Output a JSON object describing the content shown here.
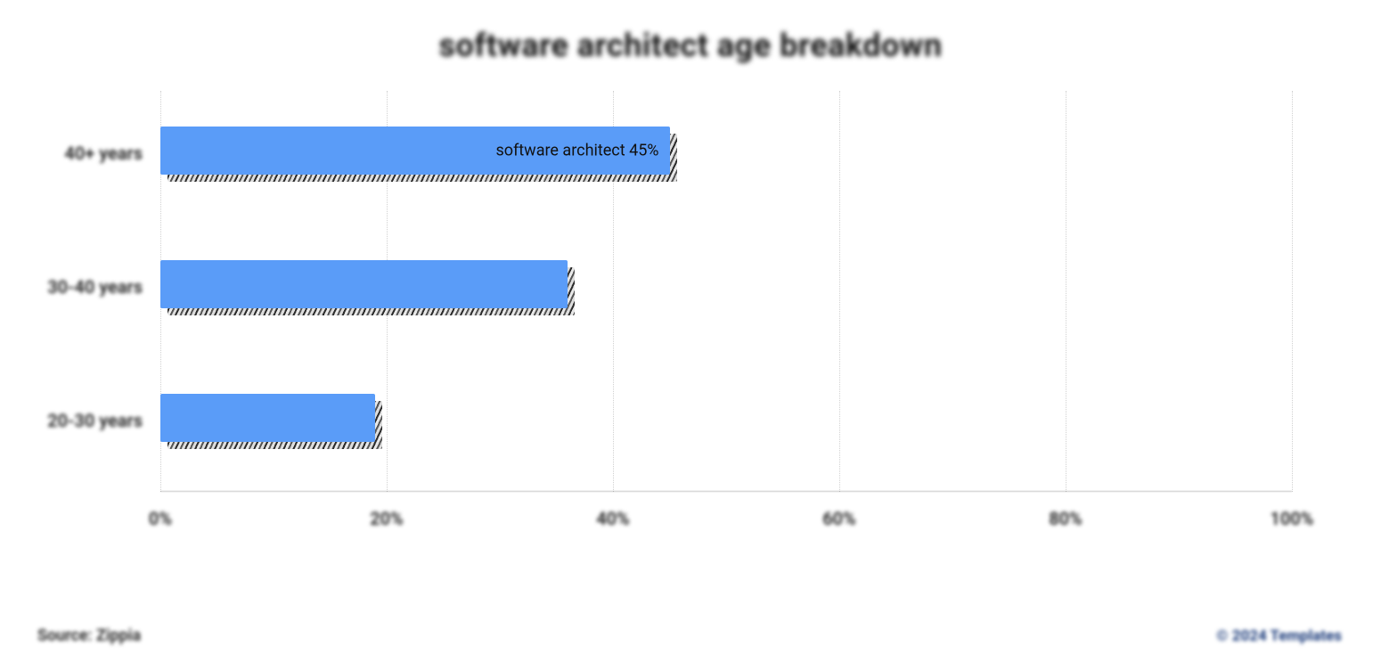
{
  "chart_data": {
    "type": "bar",
    "orientation": "horizontal",
    "title": "software architect age breakdown",
    "categories": [
      "40+ years",
      "30-40 years",
      "20-30 years"
    ],
    "values": [
      45,
      36,
      19
    ],
    "xlabel": "",
    "ylabel": "",
    "xlim": [
      0,
      100
    ],
    "x_ticks": [
      0,
      20,
      40,
      60,
      80,
      100
    ],
    "x_tick_labels": [
      "0%",
      "20%",
      "40%",
      "60%",
      "80%",
      "100%"
    ],
    "bar_color": "#5a9cf8",
    "data_labels": [
      "software architect 45%",
      "",
      ""
    ]
  },
  "footer": {
    "source": "Source: Zippia",
    "copyright": "© 2024 Templates"
  }
}
